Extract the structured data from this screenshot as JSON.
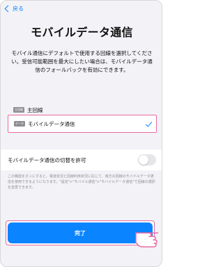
{
  "nav": {
    "back_label": "戻る"
  },
  "page": {
    "title": "モバイルデータ通信",
    "description": "モバイル通信にデフォルトで使用する回線を選択してください。受信可能範囲を最大にしたい場合は、モバイルデータ通信のフォールバックを有効にできます。"
  },
  "lines": {
    "primary": {
      "badge": "主回線",
      "label": "主回線"
    },
    "selected": {
      "badge": "データ",
      "label": "モバイルデータ通信"
    }
  },
  "switch": {
    "label": "モバイルデータ通信の切替を許可",
    "state": "off"
  },
  "note": "この機能をオンにすると、電波状況と回線利用状況に応じて、両方の回線のモバイルデータ通信を使用できるようになります。\"設定\">\"モバイル通信\">\"モバイルデータ通信\"で回線の選択を変更できます。",
  "done_button": {
    "label": "完了"
  },
  "colors": {
    "accent": "#0a84ff",
    "highlight": "#e96aa1"
  }
}
